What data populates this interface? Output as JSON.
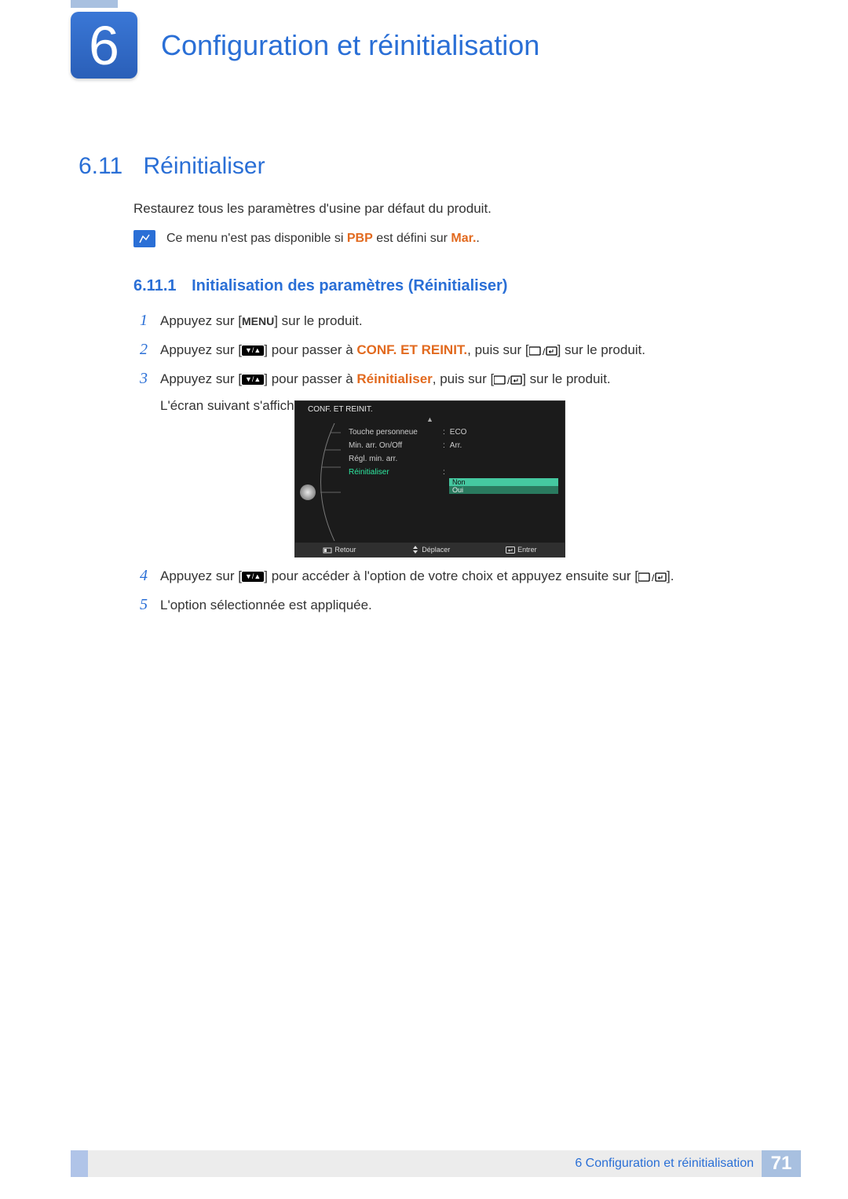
{
  "header": {
    "chapter_number": "6",
    "chapter_title": "Configuration et réinitialisation"
  },
  "section": {
    "number": "6.11",
    "title": "Réinitialiser",
    "intro": "Restaurez tous les paramètres d'usine par défaut du produit."
  },
  "note": {
    "prefix": "Ce menu n'est pas disponible si ",
    "kw": "PBP",
    "middle": " est défini sur ",
    "kw2": "Mar.",
    "suffix": "."
  },
  "subsection": {
    "number": "6.11.1",
    "title": "Initialisation des paramètres (Réinitialiser)"
  },
  "steps": {
    "s1_a": "Appuyez sur [",
    "s1_menu": "MENU",
    "s1_b": "] sur le produit.",
    "s2_a": "Appuyez sur [",
    "s2_b": "] pour passer à ",
    "s2_kw": "CONF. ET REINIT.",
    "s2_c": ", puis sur [",
    "s2_d": "] sur le produit.",
    "s3_a": "Appuyez sur [",
    "s3_b": "] pour passer à ",
    "s3_kw": "Réinitialiser",
    "s3_c": ", puis sur [",
    "s3_d": "] sur le produit.",
    "s3_sub": "L'écran suivant s'affiche.",
    "s4_a": "Appuyez sur [",
    "s4_b": "] pour accéder à l'option de votre choix et appuyez ensuite sur [",
    "s4_c": "].",
    "s5": "L'option sélectionnée est appliquée."
  },
  "osd": {
    "title": "CONF. ET REINIT.",
    "rows": {
      "r1_label": "Touche personneue",
      "r1_val": "ECO",
      "r2_label": "Min. arr. On/Off",
      "r2_val": "Arr.",
      "r3_label": "Régl. min. arr.",
      "r4_label": "Réinitialiser"
    },
    "opt_no": "Non",
    "opt_yes": "Oui",
    "footer": {
      "back": "Retour",
      "move": "Déplacer",
      "enter": "Entrer"
    }
  },
  "footer": {
    "chapter_ref": "6 Configuration et réinitialisation",
    "page": "71"
  }
}
